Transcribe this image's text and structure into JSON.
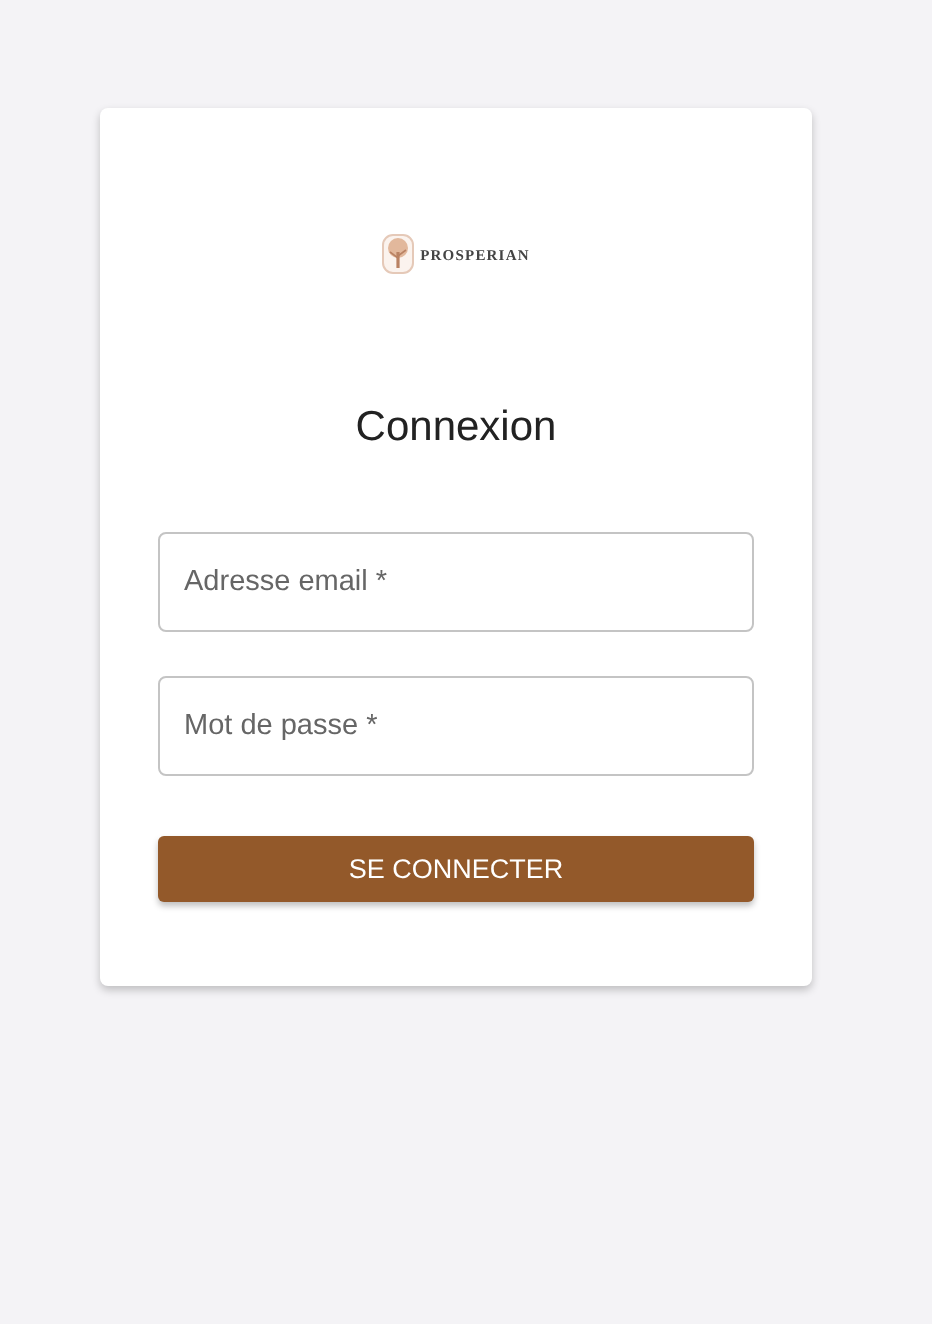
{
  "logo": {
    "text": "PROSPERIAN"
  },
  "title": "Connexion",
  "fields": [
    {
      "placeholder": "Adresse email *"
    },
    {
      "placeholder": "Mot de passe *"
    }
  ],
  "submit": {
    "label": "SE CONNECTER"
  }
}
